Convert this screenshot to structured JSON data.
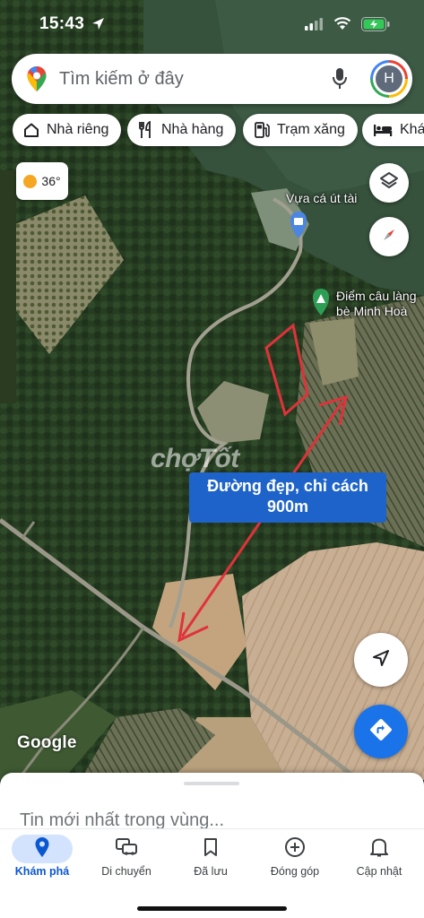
{
  "status_bar": {
    "time": "15:43"
  },
  "search": {
    "placeholder": "Tìm kiếm ở đây",
    "avatar_initial": "H"
  },
  "chips": [
    {
      "label": "Nhà riêng",
      "icon": "home-icon"
    },
    {
      "label": "Nhà hàng",
      "icon": "fork-knife-icon"
    },
    {
      "label": "Trạm xăng",
      "icon": "gas-pump-icon"
    },
    {
      "label": "Khác",
      "icon": "bed-icon"
    }
  ],
  "weather": {
    "temperature": "36°"
  },
  "map": {
    "places": [
      {
        "name": "Vựa cá út tài",
        "icon": "shopping-bag-pin-icon"
      },
      {
        "name": "Điểm câu làng bè Minh Hoà",
        "line1": "Điểm câu làng",
        "line2": "bè Minh Hoà",
        "icon": "park-pin-icon"
      }
    ],
    "annotation": {
      "line1": "Đường đẹp, chỉ cách",
      "line2": "900m",
      "color": "#1e63c9"
    },
    "watermark": "chợTốt",
    "attribution": "Google",
    "arrow_color": "#e0323a",
    "plot_outline_color": "#e0323a"
  },
  "sheet": {
    "title": "Tin mới nhất trong vùng..."
  },
  "bottom_nav": {
    "items": [
      {
        "label": "Khám phá",
        "icon": "location-pin-icon",
        "active": true
      },
      {
        "label": "Di chuyển",
        "icon": "car-icon",
        "active": false
      },
      {
        "label": "Đã lưu",
        "icon": "bookmark-icon",
        "active": false
      },
      {
        "label": "Đóng góp",
        "icon": "plus-circle-icon",
        "active": false
      },
      {
        "label": "Cập nhật",
        "icon": "bell-icon",
        "active": false
      }
    ]
  },
  "colors": {
    "accent": "#1a73e8",
    "active_nav": "#0b57d0"
  }
}
